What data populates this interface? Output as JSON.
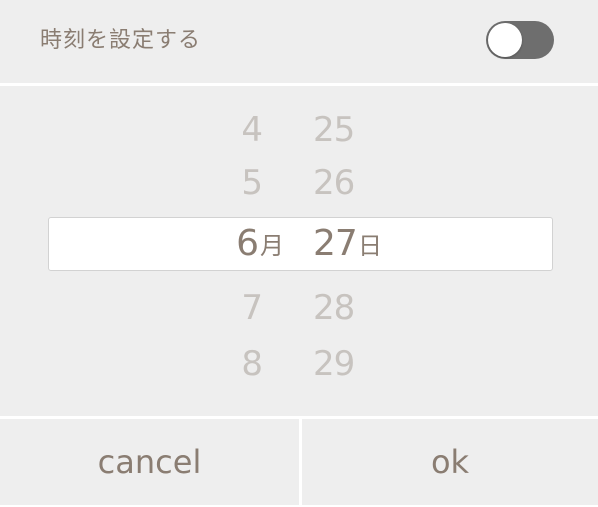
{
  "header": {
    "title": "時刻を設定する",
    "toggle_on": false
  },
  "picker": {
    "month_column": [
      "4",
      "5",
      "6",
      "7",
      "8"
    ],
    "day_column": [
      "25",
      "26",
      "27",
      "28",
      "29"
    ],
    "selected_index": 2,
    "month_unit": "月",
    "day_unit": "日"
  },
  "footer": {
    "cancel_label": "cancel",
    "ok_label": "ok"
  },
  "colors": {
    "accent_text": "#8a7d72",
    "faded_text": "#c7c3bf",
    "toggle_track": "#6e6e6e",
    "panel_bg": "#eeeeee"
  }
}
